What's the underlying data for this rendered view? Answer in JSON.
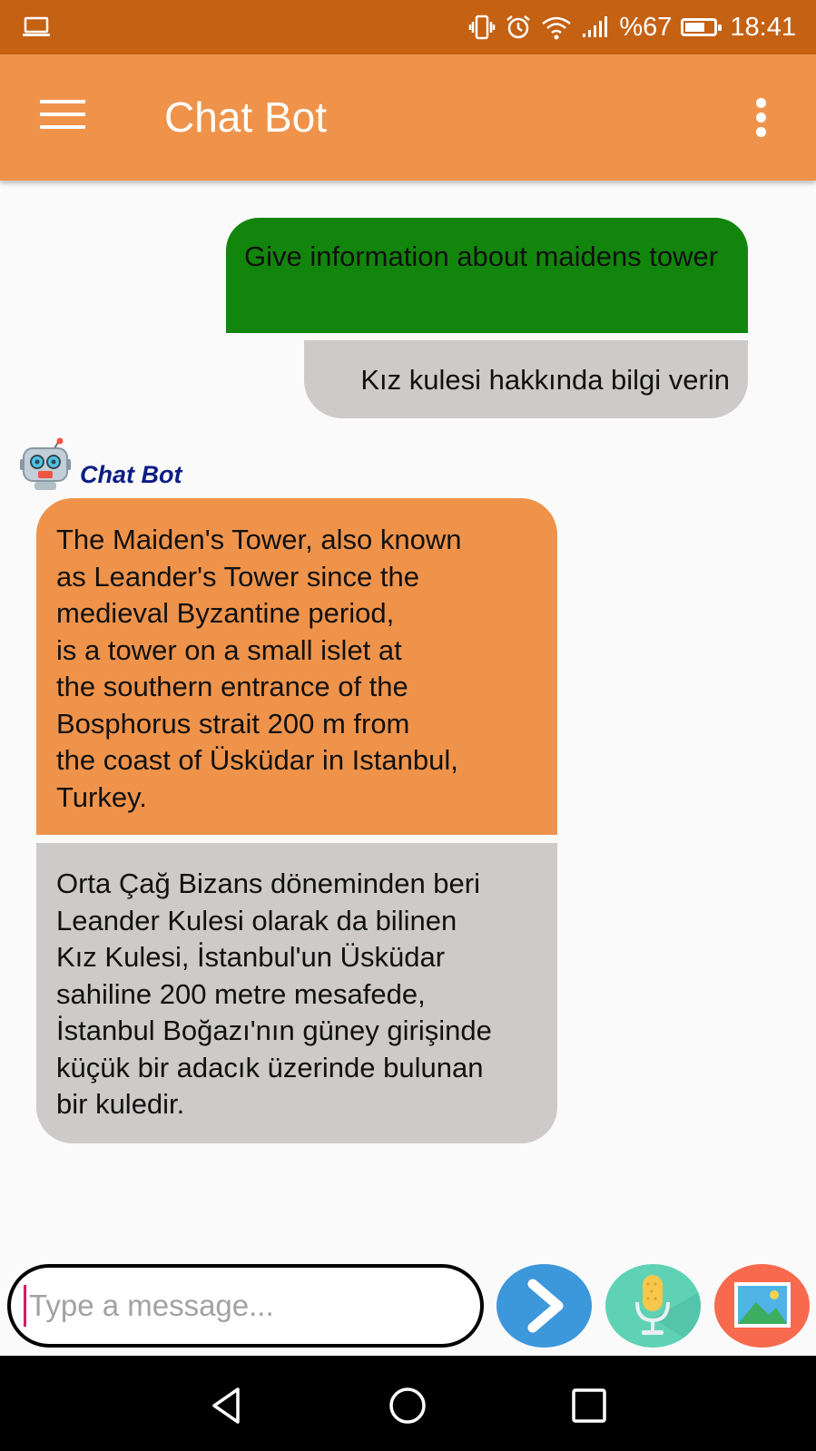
{
  "status_bar": {
    "battery_percent": "%67",
    "time": "18:41",
    "icons": [
      "laptop-icon",
      "vibrate-icon",
      "alarm-icon",
      "wifi-icon",
      "signal-icon",
      "battery-icon"
    ]
  },
  "app_bar": {
    "title": "Chat Bot",
    "icons": [
      "menu-icon",
      "more-vert-icon"
    ]
  },
  "messages": {
    "user": {
      "english": "Give information about maidens tower",
      "turkish": "Kız kulesi hakkında bilgi verin"
    },
    "bot": {
      "name": "Chat Bot",
      "english": "The Maiden's Tower, also known\nas Leander's Tower since the\nmedieval Byzantine period,\nis a tower on a small islet at\nthe southern entrance of the\nBosphorus strait 200 m from\nthe coast of Üsküdar in Istanbul,\nTurkey.",
      "turkish": "Orta Çağ Bizans döneminden beri\nLeander Kulesi olarak da bilinen\nKız Kulesi, İstanbul'un Üsküdar\nsahiline 200 metre mesafede,\nİstanbul Boğazı'nın güney girişinde\nküçük bir adacık üzerinde bulunan\nbir kuledir."
    }
  },
  "composer": {
    "value": "",
    "placeholder": "Type a message..."
  },
  "colors": {
    "status_bar": "#c56113",
    "app_bar": "#ef934b",
    "user_bubble": "#12850c",
    "translation_bubble": "#cdcac9",
    "bot_bubble": "#ef934b",
    "bot_name": "#0d1d84",
    "send_button": "#3d97db",
    "mic_button": "#5fd2b6",
    "image_button": "#f86a4e"
  },
  "nav_bar": {
    "icons": [
      "back-icon",
      "home-icon",
      "recents-icon"
    ]
  }
}
